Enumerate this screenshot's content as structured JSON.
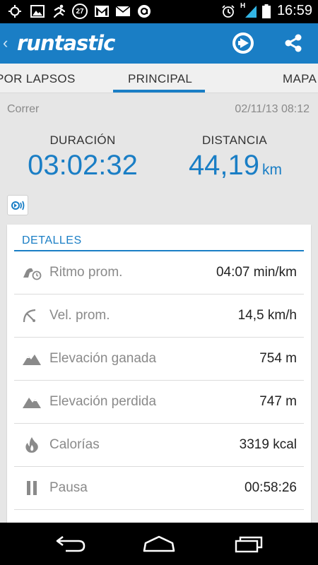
{
  "status_bar": {
    "notification_badge": "27",
    "network_type": "H",
    "time": "16:59"
  },
  "app_bar": {
    "logo_text": "runtastic"
  },
  "tabs": [
    {
      "label": "POR LAPSOS",
      "active": false
    },
    {
      "label": "PRINCIPAL",
      "active": true
    },
    {
      "label": "MAPA",
      "active": false
    }
  ],
  "activity": {
    "type": "Correr",
    "datetime": "02/11/13 08:12"
  },
  "summary": {
    "duration_label": "DURACIÓN",
    "duration_value": "03:02:32",
    "distance_label": "DISTANCIA",
    "distance_value": "44,19",
    "distance_unit": "km"
  },
  "details": {
    "title": "DETALLES",
    "rows": [
      {
        "icon": "pace-icon",
        "label": "Ritmo prom.",
        "value": "04:07 min/km"
      },
      {
        "icon": "speedometer-icon",
        "label": "Vel. prom.",
        "value": "14,5  km/h"
      },
      {
        "icon": "elevation-gain-icon",
        "label": "Elevación ganada",
        "value": "754 m"
      },
      {
        "icon": "elevation-loss-icon",
        "label": "Elevación perdida",
        "value": "747 m"
      },
      {
        "icon": "flame-icon",
        "label": "Calorías",
        "value": "3319 kcal"
      },
      {
        "icon": "pause-icon",
        "label": "Pausa",
        "value": "00:58:26"
      }
    ]
  },
  "colors": {
    "brand_blue": "#1a7ec5",
    "icon_gray": "#8a8a8a"
  }
}
